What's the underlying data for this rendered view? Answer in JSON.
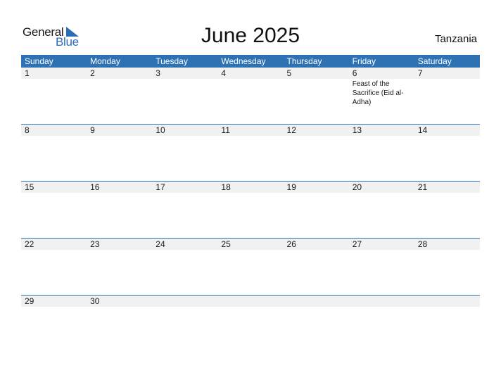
{
  "logo": {
    "general": "General",
    "blue": "Blue"
  },
  "title": "June 2025",
  "country": "Tanzania",
  "colors": {
    "accent": "#2e72b4",
    "band": "#f1f1f1"
  },
  "weekdays": [
    "Sunday",
    "Monday",
    "Tuesday",
    "Wednesday",
    "Thursday",
    "Friday",
    "Saturday"
  ],
  "weeks": [
    [
      {
        "d": "1"
      },
      {
        "d": "2"
      },
      {
        "d": "3"
      },
      {
        "d": "4"
      },
      {
        "d": "5"
      },
      {
        "d": "6",
        "event": "Feast of the Sacrifice (Eid al-Adha)"
      },
      {
        "d": "7"
      }
    ],
    [
      {
        "d": "8"
      },
      {
        "d": "9"
      },
      {
        "d": "10"
      },
      {
        "d": "11"
      },
      {
        "d": "12"
      },
      {
        "d": "13"
      },
      {
        "d": "14"
      }
    ],
    [
      {
        "d": "15"
      },
      {
        "d": "16"
      },
      {
        "d": "17"
      },
      {
        "d": "18"
      },
      {
        "d": "19"
      },
      {
        "d": "20"
      },
      {
        "d": "21"
      }
    ],
    [
      {
        "d": "22"
      },
      {
        "d": "23"
      },
      {
        "d": "24"
      },
      {
        "d": "25"
      },
      {
        "d": "26"
      },
      {
        "d": "27"
      },
      {
        "d": "28"
      }
    ],
    [
      {
        "d": "29"
      },
      {
        "d": "30"
      },
      {
        "d": ""
      },
      {
        "d": ""
      },
      {
        "d": ""
      },
      {
        "d": ""
      },
      {
        "d": ""
      }
    ]
  ]
}
